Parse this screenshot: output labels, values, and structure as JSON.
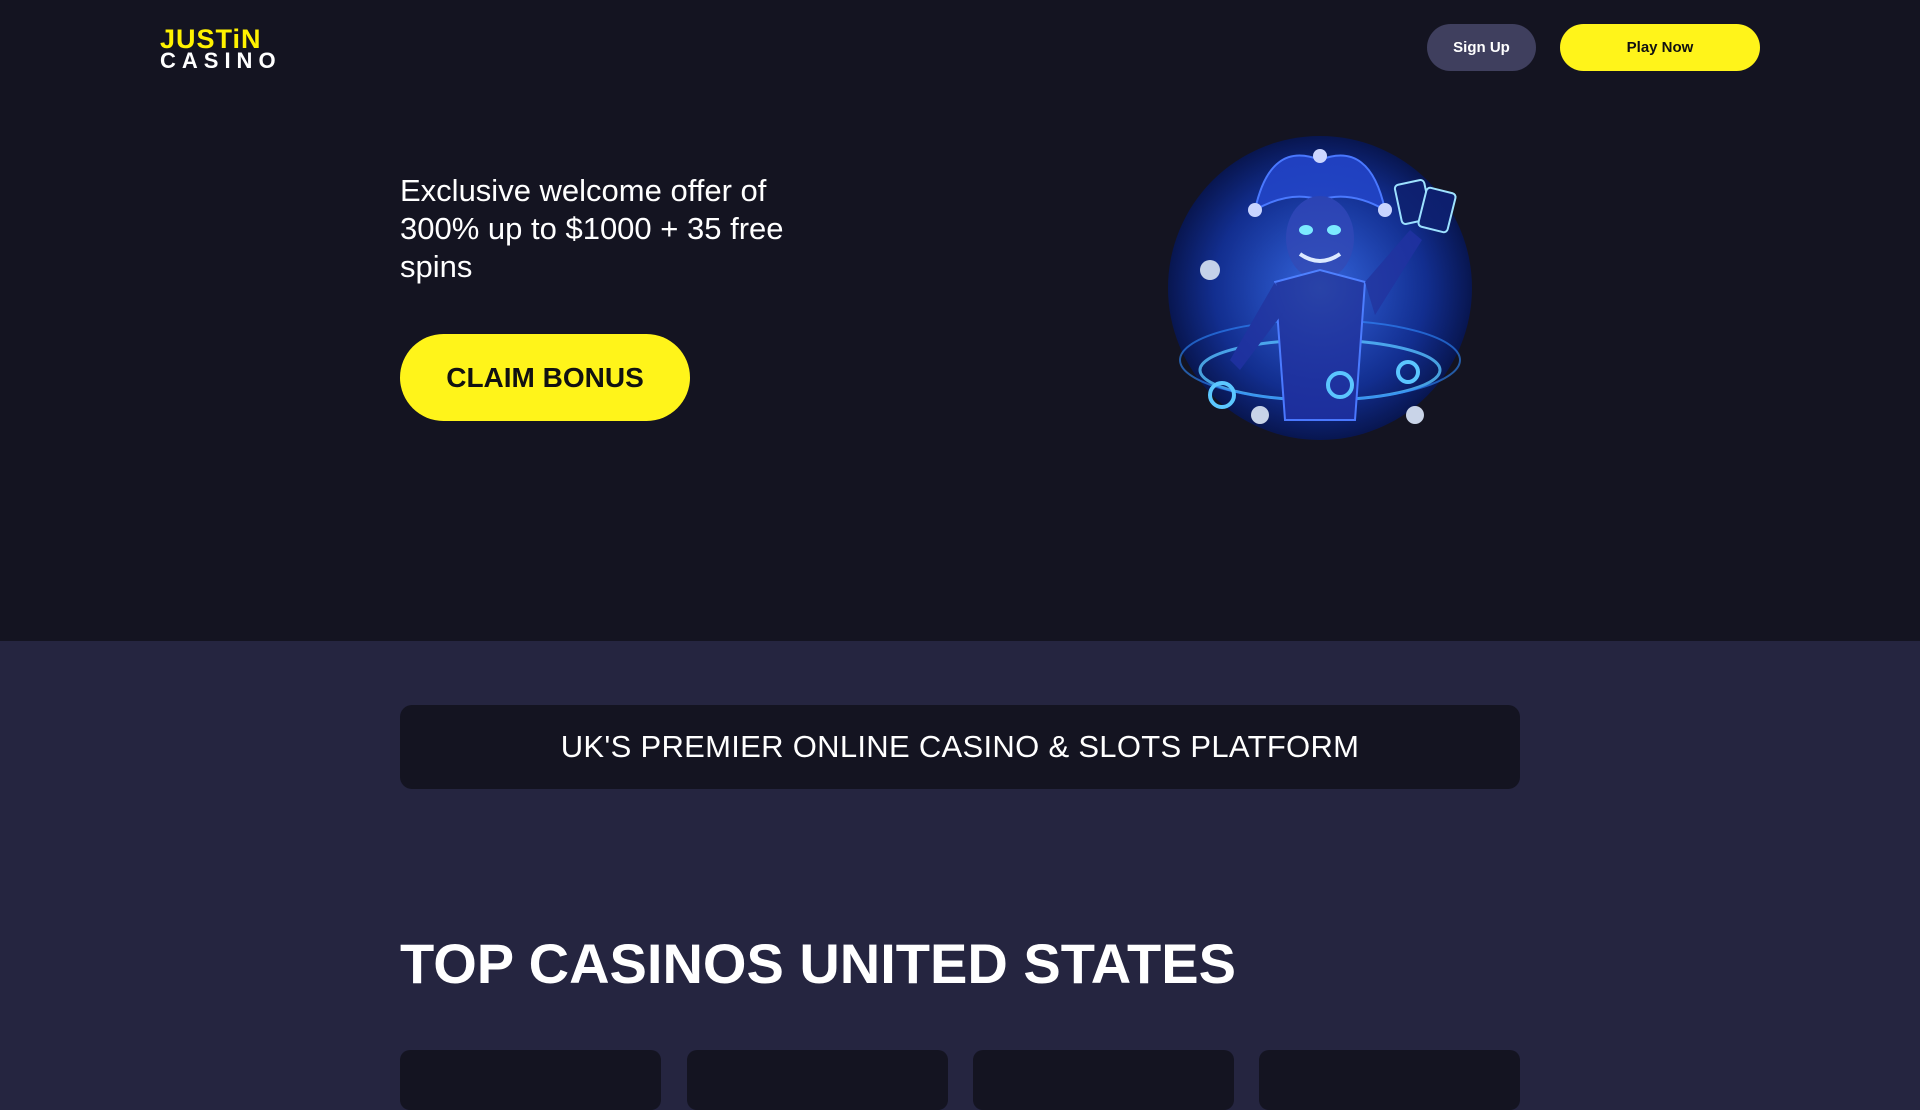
{
  "header": {
    "logo_top": "JUSTiN",
    "logo_bottom": "CASINO",
    "sign_up_label": "Sign Up",
    "play_now_label": "Play Now"
  },
  "hero": {
    "offer_text": "Exclusive welcome offer of 300% up to $1000 + 35 free spins",
    "claim_label": "CLAIM BONUS",
    "image_icon": "joker-mascot-icon"
  },
  "tagline": "UK'S PREMIER ONLINE CASINO & SLOTS PLATFORM",
  "top_casinos": {
    "title": "TOP CASINOS UNITED STATES",
    "cards": [
      "",
      "",
      "",
      ""
    ]
  },
  "colors": {
    "hero_bg": "#141421",
    "page_bg": "#252540",
    "accent_yellow": "#fff41a",
    "secondary_button": "#3f3f5e",
    "joker_blue": "#1e4fd8"
  }
}
